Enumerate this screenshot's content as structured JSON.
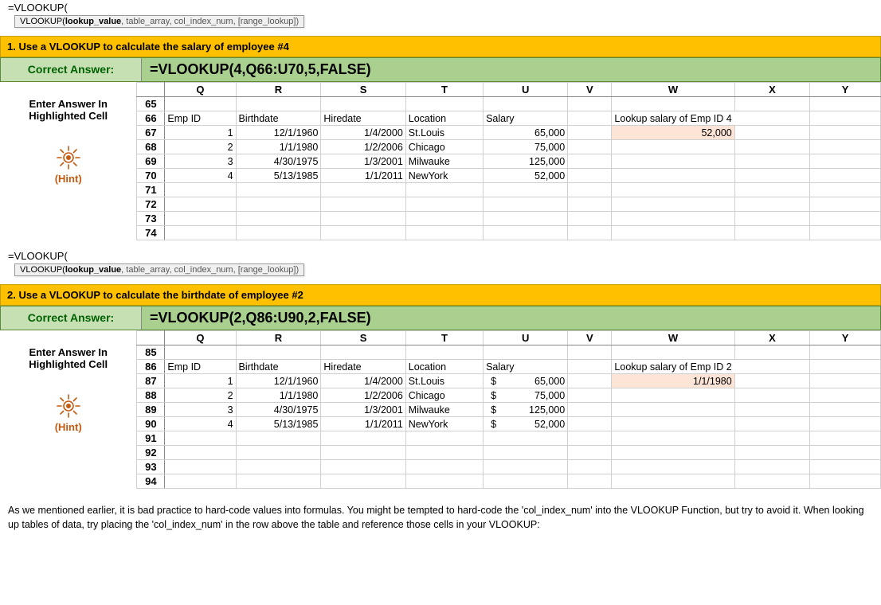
{
  "formula_text": "=VLOOKUP(",
  "tooltip_fn": "VLOOKUP(",
  "tooltip_bold": "lookup_value",
  "tooltip_rest": ", table_array, col_index_num, [range_lookup])",
  "ex1": {
    "header": "1. Use a VLOOKUP to calculate the salary of employee #4",
    "correct_label": "Correct Answer:",
    "formula": "=VLOOKUP(4,Q66:U70,5,FALSE)",
    "left_top": "Enter Answer In Highlighted Cell",
    "hint": "(Hint)",
    "cols": [
      "Q",
      "R",
      "S",
      "T",
      "U",
      "V",
      "W",
      "X",
      "Y"
    ],
    "rows": [
      "65",
      "66",
      "67",
      "68",
      "69",
      "70",
      "71",
      "72",
      "73",
      "74"
    ],
    "h_row": {
      "q": "Emp ID",
      "r": "Birthdate",
      "s": "Hiredate",
      "t": "Location",
      "u": "Salary",
      "w": "Lookup salary of Emp ID 4"
    },
    "data": [
      {
        "id": "1",
        "bd": "12/1/1960",
        "hd": "1/4/2000",
        "loc": "St.Louis",
        "sal": "65,000"
      },
      {
        "id": "2",
        "bd": "1/1/1980",
        "hd": "1/2/2006",
        "loc": "Chicago",
        "sal": "75,000"
      },
      {
        "id": "3",
        "bd": "4/30/1975",
        "hd": "1/3/2001",
        "loc": "Milwauke",
        "sal": "125,000"
      },
      {
        "id": "4",
        "bd": "5/13/1985",
        "hd": "1/1/2011",
        "loc": "NewYork",
        "sal": "52,000"
      }
    ],
    "result": "52,000"
  },
  "ex2": {
    "header": "2. Use a VLOOKUP to calculate the birthdate of employee #2",
    "correct_label": "Correct Answer:",
    "formula": "=VLOOKUP(2,Q86:U90,2,FALSE)",
    "left_top": "Enter Answer In Highlighted Cell",
    "hint": "(Hint)",
    "cols": [
      "Q",
      "R",
      "S",
      "T",
      "U",
      "V",
      "W",
      "X",
      "Y"
    ],
    "rows": [
      "85",
      "86",
      "87",
      "88",
      "89",
      "90",
      "91",
      "92",
      "93",
      "94"
    ],
    "h_row": {
      "q": "Emp ID",
      "r": "Birthdate",
      "s": "Hiredate",
      "t": "Location",
      "u": "Salary",
      "w": "Lookup salary of Emp ID 2"
    },
    "data": [
      {
        "id": "1",
        "bd": "12/1/1960",
        "hd": "1/4/2000",
        "loc": "St.Louis",
        "sal": "65,000"
      },
      {
        "id": "2",
        "bd": "1/1/1980",
        "hd": "1/2/2006",
        "loc": "Chicago",
        "sal": "75,000"
      },
      {
        "id": "3",
        "bd": "4/30/1975",
        "hd": "1/3/2001",
        "loc": "Milwauke",
        "sal": "125,000"
      },
      {
        "id": "4",
        "bd": "5/13/1985",
        "hd": "1/1/2011",
        "loc": "NewYork",
        "sal": "52,000"
      }
    ],
    "result": "1/1/1980"
  },
  "dollar": "$",
  "paragraph": "As we mentioned earlier, it is bad practice to hard-code values into formulas. You might be tempted to hard-code the 'col_index_num' into the VLOOKUP Function, but try to avoid it. When looking up tables of data, try placing the 'col_index_num' in the row above the table and reference those cells in your VLOOKUP:"
}
